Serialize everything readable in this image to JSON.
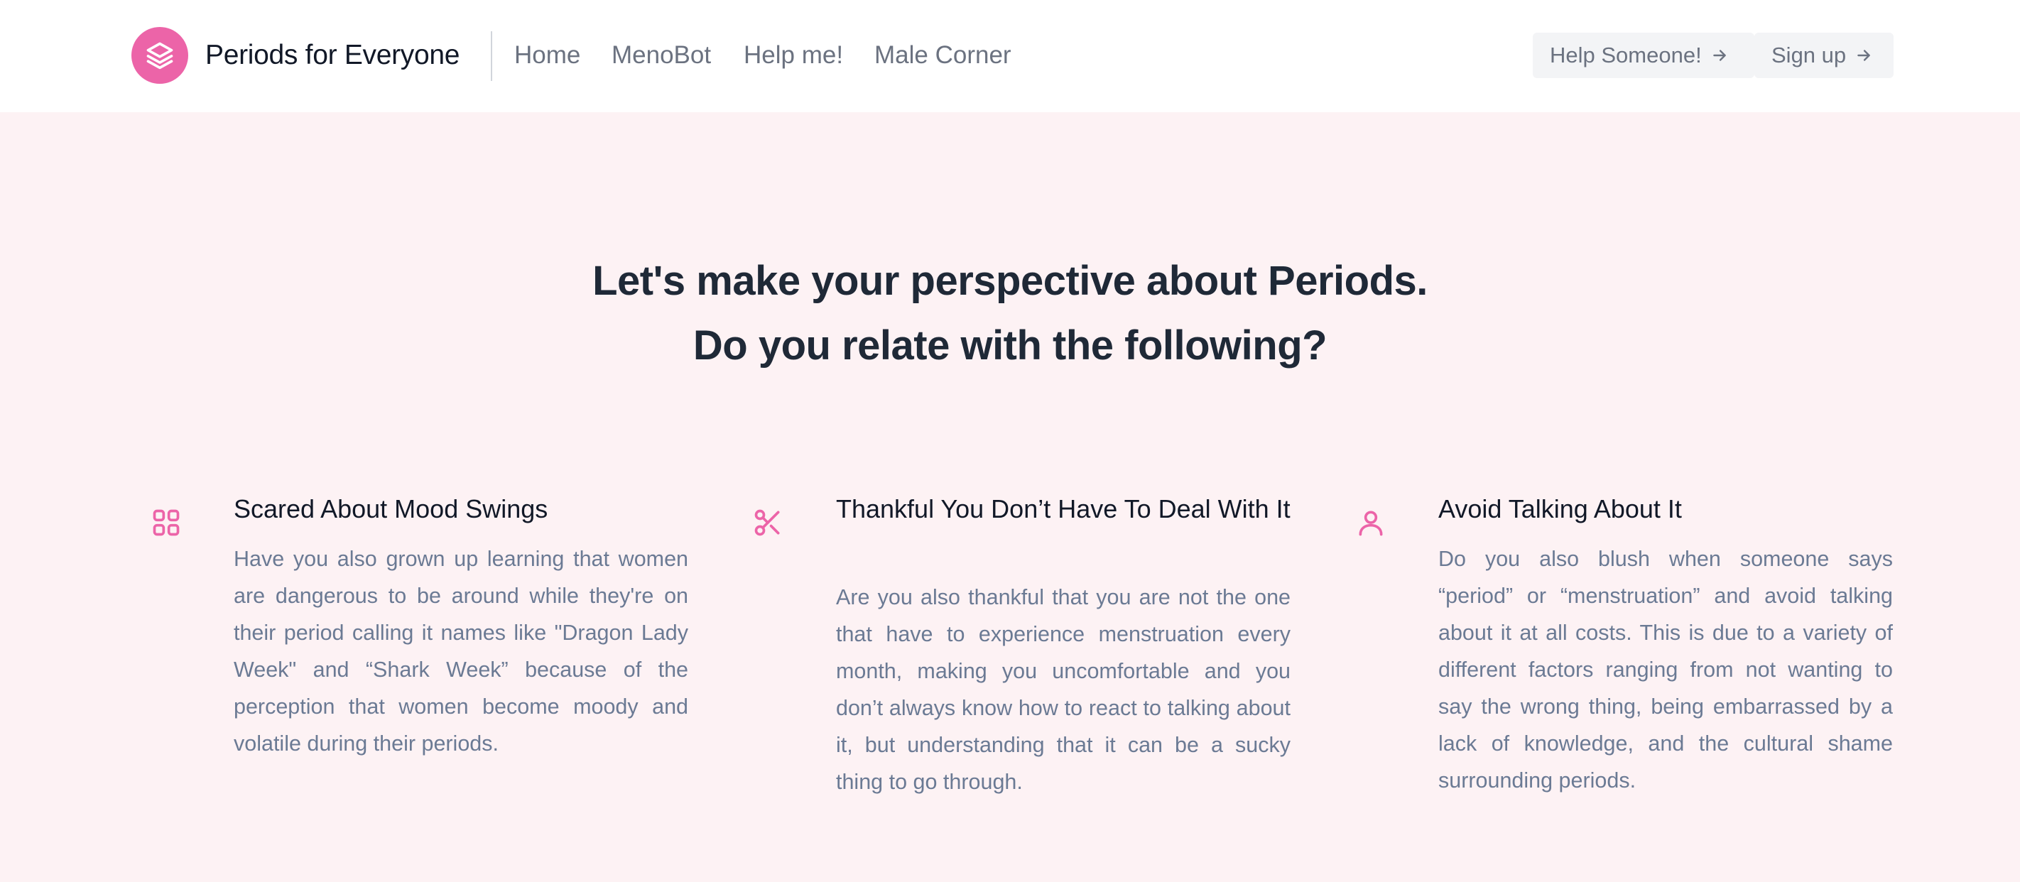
{
  "header": {
    "logo_icon": "layers-icon",
    "brand": "Periods for Everyone",
    "nav": [
      "Home",
      "MenoBot",
      "Help me!",
      "Male Corner"
    ],
    "buttons": {
      "help_someone": "Help Someone!",
      "sign_up": "Sign up"
    }
  },
  "hero": {
    "line1": "Let's make your perspective about Periods.",
    "line2": "Do you relate with the following?"
  },
  "features": [
    {
      "icon": "grid-icon",
      "title": "Scared About Mood Swings",
      "body": "Have you also grown up learning that women are dangerous to be around while they're on their period calling it names like \"Dragon Lady Week\" and “Shark Week” because of the perception that women become moody and volatile during their periods."
    },
    {
      "icon": "scissors-icon",
      "title": "Thankful You Don’t Have To Deal With It",
      "body": "Are you also thankful that you are not the one that have to experience menstruation every month, making you uncomfortable and you don’t always know how to react to talking about it, but understanding that it can be a sucky thing to go through."
    },
    {
      "icon": "user-icon",
      "title": "Avoid Talking About It",
      "body": "Do you also blush when someone says “period” or “menstruation” and avoid talking about it at all costs. This is due to a variety of different factors ranging from not wanting to say the wrong thing, being embarrassed by a lack of knowledge, and the cultural shame surrounding periods."
    }
  ],
  "colors": {
    "accent": "#ec64a8",
    "page_background": "#fdf2f4",
    "header_background": "#ffffff",
    "heading": "#1f2937",
    "body_text": "#6b7a94",
    "nav_text": "#6b7280"
  }
}
